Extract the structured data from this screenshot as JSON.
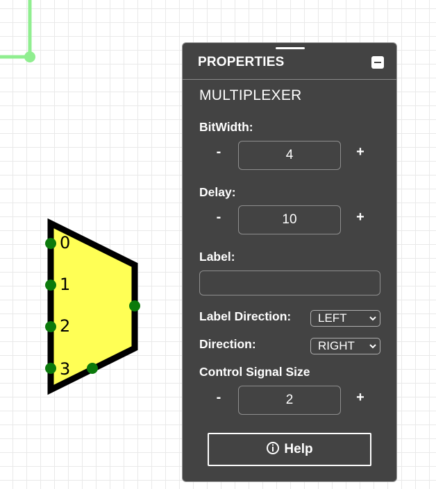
{
  "properties_panel": {
    "title": "PROPERTIES",
    "component_name": "MULTIPLEXER",
    "bitwidth": {
      "label": "BitWidth:",
      "value": "4",
      "decrement": "-",
      "increment": "+"
    },
    "delay": {
      "label": "Delay:",
      "value": "10",
      "decrement": "-",
      "increment": "+"
    },
    "label_field": {
      "label": "Label:",
      "value": ""
    },
    "label_direction": {
      "label": "Label Direction:",
      "value": "LEFT"
    },
    "direction": {
      "label": "Direction:",
      "value": "RIGHT"
    },
    "control_signal_size": {
      "label": "Control Signal Size",
      "value": "2",
      "decrement": "-",
      "increment": "+"
    },
    "help_button": {
      "label": "Help",
      "icon": "info-icon"
    },
    "minimize_icon": "minimize-icon"
  },
  "multiplexer": {
    "fill_color": "#ffff55",
    "node_color": "#0b7a0b",
    "input_labels": [
      "0",
      "1",
      "2",
      "3"
    ]
  },
  "wire_color": "#90ee90",
  "colors": {
    "panel_bg": "#434343",
    "text": "#ffffff"
  }
}
